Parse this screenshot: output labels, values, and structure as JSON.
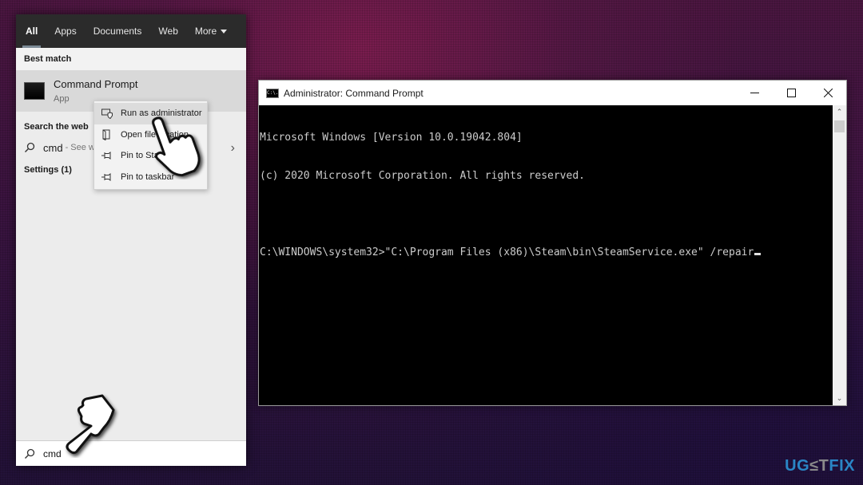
{
  "search_panel": {
    "tabs": [
      {
        "label": "All",
        "active": true
      },
      {
        "label": "Apps"
      },
      {
        "label": "Documents"
      },
      {
        "label": "Web"
      },
      {
        "label": "More"
      }
    ],
    "best_match_title": "Best match",
    "best_match": {
      "name": "Command Prompt",
      "type": "App",
      "icon": "cmd-app-icon"
    },
    "web_title": "Search the web",
    "web_item": {
      "query": "cmd",
      "sub": "- See w",
      "icon": "search-icon"
    },
    "settings_title": "Settings (1)",
    "search_input": {
      "value": "cmd",
      "icon": "search-icon"
    }
  },
  "context_menu": {
    "items": [
      {
        "label": "Run as administrator",
        "icon": "run-as-admin-shield-icon",
        "hover": true
      },
      {
        "label": "Open file location",
        "icon": "open-file-location-icon"
      },
      {
        "label": "Pin to Start",
        "icon": "pin-icon"
      },
      {
        "label": "Pin to taskbar",
        "icon": "pin-icon"
      }
    ]
  },
  "cmd_window": {
    "title": "Administrator: Command Prompt",
    "icon_text": "C:\\.",
    "controls": {
      "minimize": "minimize-icon",
      "maximize": "maximize-icon",
      "close": "close-icon"
    },
    "lines": [
      "Microsoft Windows [Version 10.0.19042.804]",
      "(c) 2020 Microsoft Corporation. All rights reserved.",
      "",
      "C:\\WINDOWS\\system32>\"C:\\Program Files (x86)\\Steam\\bin\\SteamService.exe\" /repair"
    ]
  },
  "watermark": {
    "part1": "UG",
    "part2": "≤T",
    "part3": "FIX"
  }
}
